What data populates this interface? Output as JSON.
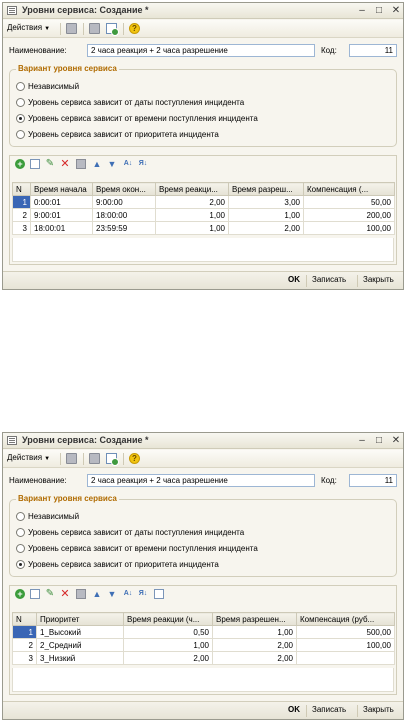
{
  "window1": {
    "title": "Уровни сервиса: Создание *",
    "toolbar": {
      "actions_label": "Действия"
    },
    "name_label": "Наименование:",
    "name_value": "2 часа реакция + 2 часа разрешение",
    "code_label": "Код:",
    "code_value": "11",
    "group_title": "Вариант уровня сервиса",
    "radios": [
      {
        "label": "Независимый",
        "selected": false
      },
      {
        "label": "Уровень сервиса зависит от даты поступления инцидента",
        "selected": false
      },
      {
        "label": "Уровень сервиса зависит от времени поступления инцидента",
        "selected": true
      },
      {
        "label": "Уровень сервиса зависит от приоритета инцидента",
        "selected": false
      }
    ],
    "table": {
      "columns": [
        "N",
        "Время начала",
        "Время окон...",
        "Время реакци...",
        "Время разреш...",
        "Компенсация (..."
      ],
      "rows": [
        [
          "1",
          "0:00:01",
          "9:00:00",
          "2,00",
          "3,00",
          "50,00"
        ],
        [
          "2",
          "9:00:01",
          "18:00:00",
          "1,00",
          "1,00",
          "200,00"
        ],
        [
          "3",
          "18:00:01",
          "23:59:59",
          "1,00",
          "2,00",
          "100,00"
        ]
      ]
    },
    "buttons": {
      "ok": "OK",
      "save": "Записать",
      "close": "Закрыть"
    }
  },
  "window2": {
    "title": "Уровни сервиса: Создание *",
    "toolbar": {
      "actions_label": "Действия"
    },
    "name_label": "Наименование:",
    "name_value": "2 часа реакция + 2 часа разрешение",
    "code_label": "Код:",
    "code_value": "11",
    "group_title": "Вариант уровня сервиса",
    "radios": [
      {
        "label": "Независимый",
        "selected": false
      },
      {
        "label": "Уровень сервиса зависит от даты поступления инцидента",
        "selected": false
      },
      {
        "label": "Уровень сервиса зависит от времени поступления инцидента",
        "selected": false
      },
      {
        "label": "Уровень сервиса зависит от приоритета инцидента",
        "selected": true
      }
    ],
    "table": {
      "columns": [
        "N",
        "Приоритет",
        "Время реакции (ч...",
        "Время разрешен...",
        "Компенсация (руб..."
      ],
      "rows": [
        [
          "1",
          "1_Высокий",
          "0,50",
          "1,00",
          "500,00"
        ],
        [
          "2",
          "2_Средний",
          "1,00",
          "2,00",
          "100,00"
        ],
        [
          "3",
          "3_Низкий",
          "2,00",
          "2,00",
          ""
        ]
      ]
    },
    "buttons": {
      "ok": "OK",
      "save": "Записать",
      "close": "Закрыть"
    }
  }
}
